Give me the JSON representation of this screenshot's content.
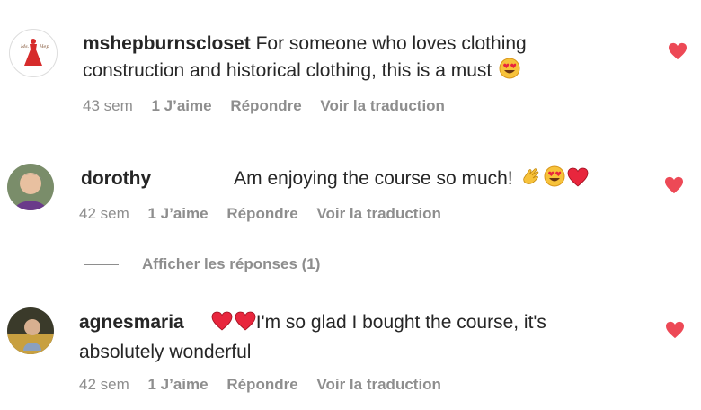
{
  "comments": [
    {
      "username": "mshepburnscloset",
      "text": "For someone who loves clothing construction and historical clothing, this is a must",
      "time": "43 sem",
      "likes": "1 J’aime",
      "reply": "Répondre",
      "translate": "Voir la traduction"
    },
    {
      "username": "dorothy",
      "text": "Am enjoying the course so much!",
      "time": "42 sem",
      "likes": "1 J’aime",
      "reply": "Répondre",
      "translate": "Voir la traduction"
    },
    {
      "username": "agnesmaria",
      "text": "I'm so glad I bought the course, it's absolutely wonderful",
      "time": "42 sem",
      "likes": "1 J’aime",
      "reply": "Répondre",
      "translate": "Voir la traduction"
    }
  ],
  "view_replies": "Afficher les réponses (1)",
  "colors": {
    "heart": "#ed4956",
    "meta": "#8e8e8e",
    "text": "#262626"
  },
  "icons": [
    "heart-icon",
    "heart-eyes-emoji",
    "clapping-hands-emoji",
    "red-heart-emoji"
  ]
}
